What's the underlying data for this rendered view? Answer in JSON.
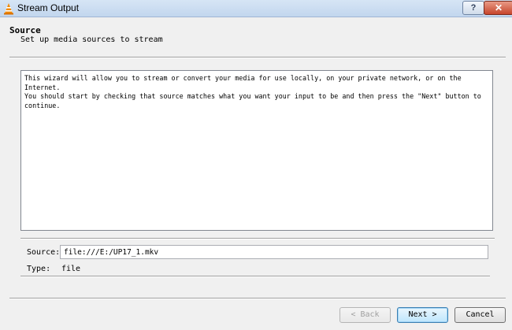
{
  "window": {
    "title": "Stream Output",
    "help_label": "?",
    "close_label": "✕"
  },
  "header": {
    "title": "Source",
    "subtitle": "Set up media sources to stream"
  },
  "info": {
    "line1": "This wizard will allow you to stream or convert your media for use locally, on your private network, or on the Internet.",
    "line2": "You should start by checking that source matches what you want your input to be and then press the \"Next\" button to continue."
  },
  "fields": {
    "source_label": "Source:",
    "source_value": "file:///E:/UP17_1.mkv",
    "type_label": "Type:",
    "type_value": "file"
  },
  "buttons": {
    "back": "< Back",
    "next": "Next >",
    "cancel": "Cancel"
  },
  "colors": {
    "vlc_orange": "#f28a00",
    "dialog_bg": "#f0f0f0"
  }
}
